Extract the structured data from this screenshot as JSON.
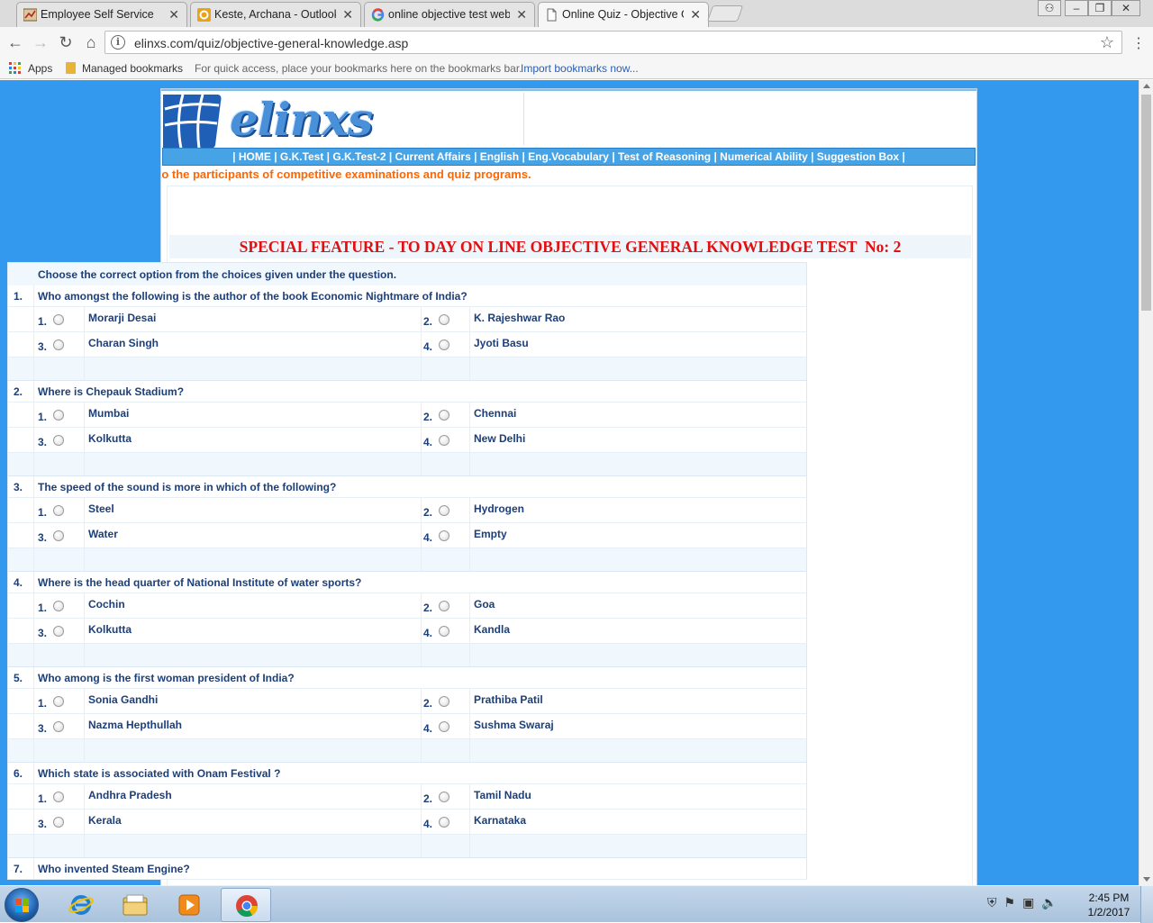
{
  "browser": {
    "tabs": [
      {
        "title": "Employee Self Service",
        "icon": "employee-portal-icon"
      },
      {
        "title": "Keste, Archana - Outlook",
        "icon": "outlook-icon"
      },
      {
        "title": "online objective test web",
        "icon": "google-icon"
      },
      {
        "title": "Online Quiz - Objective G",
        "icon": "document-icon",
        "active": true
      }
    ],
    "url": "elinxs.com/quiz/objective-general-knowledge.asp",
    "bookmarks": {
      "apps_label": "Apps",
      "managed_label": "Managed bookmarks",
      "hint": "For quick access, place your bookmarks here on the bookmarks bar.",
      "import_label": "Import bookmarks now..."
    }
  },
  "site": {
    "logo_text": "elinxs",
    "nav": [
      "| HOME |",
      " G.K.Test |",
      " G.K.Test-2 |",
      " Current Affairs |",
      " English |",
      " Eng.Vocabulary |",
      " Test of Reasoning |",
      " Numerical Ability |",
      " Suggestion Box |"
    ],
    "marquee": "to the participants of competitive examinations and quiz programs.",
    "heading": "SPECIAL FEATURE - TO DAY ON LINE OBJECTIVE GENERAL KNOWLEDGE TEST  No: 2"
  },
  "quiz": {
    "instruction": "Choose the correct option from the choices given under the question.",
    "questions": [
      {
        "num": "1.",
        "text": "Who amongst the following is the author of the book Economic Nightmare of India?",
        "options": [
          "Morarji Desai",
          "K. Rajeshwar Rao",
          "Charan Singh",
          "Jyoti Basu"
        ]
      },
      {
        "num": "2.",
        "text": "Where is Chepauk Stadium?",
        "options": [
          "Mumbai",
          "Chennai",
          "Kolkutta",
          "New Delhi"
        ]
      },
      {
        "num": "3.",
        "text": "The speed of the sound is more in which of the following?",
        "options": [
          "Steel",
          "Hydrogen",
          "Water",
          "Empty"
        ]
      },
      {
        "num": "4.",
        "text": "Where is the head quarter of National Institute of water sports?",
        "options": [
          "Cochin",
          "Goa",
          "Kolkutta",
          "Kandla"
        ]
      },
      {
        "num": "5.",
        "text": "Who among is the first woman president of India?",
        "options": [
          "Sonia Gandhi",
          "Prathiba Patil",
          "Nazma Hepthullah",
          "Sushma Swaraj"
        ]
      },
      {
        "num": "6.",
        "text": "Which state is associated with Onam Festival ?",
        "options": [
          "Andhra Pradesh",
          "Tamil Nadu",
          "Kerala",
          "Karnataka"
        ]
      },
      {
        "num": "7.",
        "text": "Who invented Steam Engine?",
        "options": []
      }
    ],
    "option_numbers": [
      "1.",
      "2.",
      "3.",
      "4."
    ]
  },
  "taskbar": {
    "time": "2:45 PM",
    "date": "1/2/2017",
    "apps": [
      "internet-explorer-icon",
      "file-explorer-icon",
      "media-player-icon",
      "chrome-icon"
    ]
  },
  "colors": {
    "page_background": "#3399ee",
    "nav_bar": "#46a4e6",
    "heading_red": "#e11010",
    "marquee_orange": "#ff6600",
    "question_text": "#1c3f7a"
  }
}
